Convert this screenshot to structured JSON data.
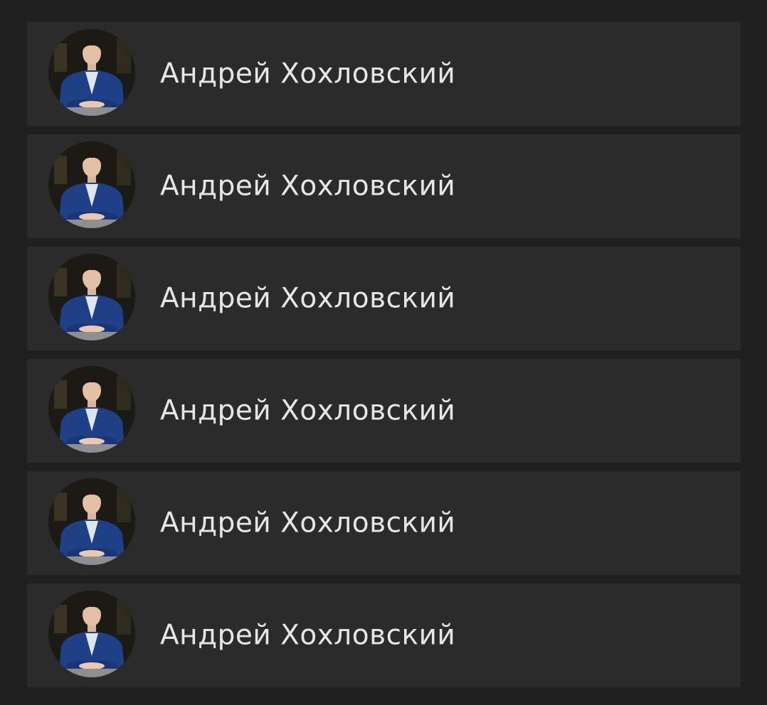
{
  "contacts": [
    {
      "name": "Андрей Хохловский",
      "avatar_icon": "person-photo-avatar"
    },
    {
      "name": "Андрей Хохловский",
      "avatar_icon": "person-photo-avatar"
    },
    {
      "name": "Андрей Хохловский",
      "avatar_icon": "person-photo-avatar"
    },
    {
      "name": "Андрей Хохловский",
      "avatar_icon": "person-photo-avatar"
    },
    {
      "name": "Андрей Хохловский",
      "avatar_icon": "person-photo-avatar"
    },
    {
      "name": "Андрей Хохловский",
      "avatar_icon": "person-photo-avatar"
    }
  ],
  "colors": {
    "background": "#1f1f1f",
    "row": "#2b2b2b",
    "text": "#e6e6e6",
    "suit": "#1f3f86"
  }
}
